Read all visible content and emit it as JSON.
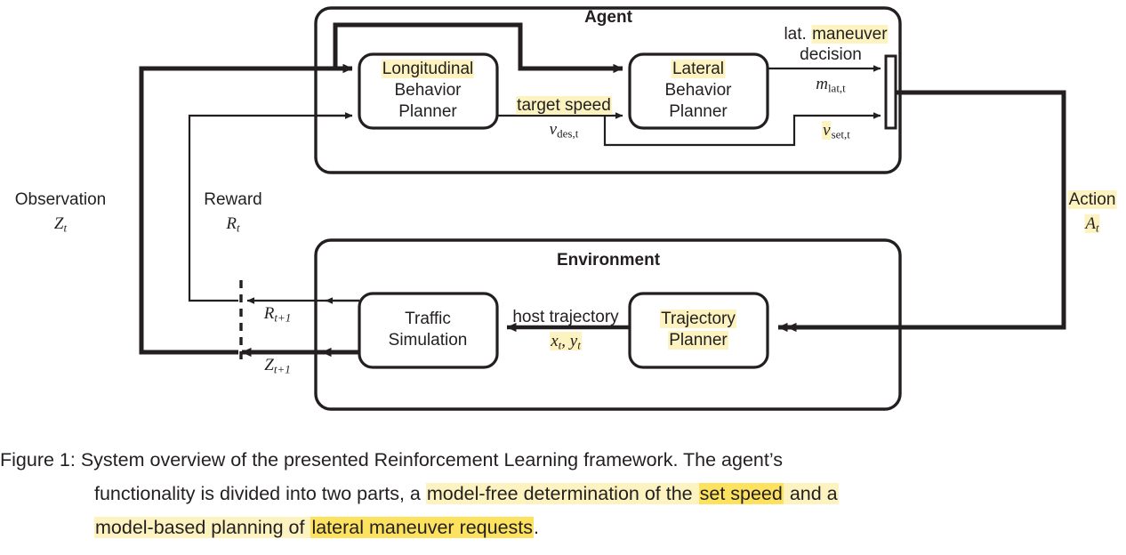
{
  "figure": {
    "agent_box_title": "Agent",
    "environment_box_title": "Environment",
    "blocks": {
      "longitudinal_behavior_planner": {
        "line1": "Longitudinal",
        "line2": "Behavior",
        "line3": "Planner"
      },
      "lateral_behavior_planner": {
        "line1": "Lateral",
        "line2": "Behavior",
        "line3": "Planner"
      },
      "traffic_simulation": {
        "line1": "Traffic",
        "line2": "Simulation"
      },
      "trajectory_planner": {
        "line1": "Trajectory",
        "line2": "Planner"
      }
    },
    "edge_labels": {
      "target_speed_text": "target speed",
      "v_des": "v",
      "v_des_sub": "des,t",
      "lat_maneuver_line1_plain": "lat. ",
      "lat_maneuver_line1_hl": "maneuver",
      "lat_maneuver_line2": "decision",
      "m_lat": "m",
      "m_lat_sub": "lat,t",
      "v_set": "v",
      "v_set_sub": "set,t",
      "host_trajectory_text": "host trajectory",
      "xt_yt": "x",
      "xt_yt_sub_1": "t",
      "xt_yt_mid": ", y",
      "xt_yt_sub_2": "t",
      "observation_text": "Observation",
      "observation_sym": "Z",
      "observation_sub": "t",
      "reward_text": "Reward",
      "reward_sym": "R",
      "reward_sub": "t",
      "action_text": "Action",
      "action_sym": "A",
      "action_sub": "t",
      "reward_next_sym": "R",
      "reward_next_sub": "t+1",
      "observation_next_sym": "Z",
      "observation_next_sub": "t+1"
    },
    "colors": {
      "stroke": "#231f20",
      "highlight_light": "#fcf3c0",
      "highlight_strong": "#fde25f",
      "background": "#ffffff"
    }
  },
  "caption": {
    "label": "Figure 1:",
    "line1_rest": " System overview of the presented Reinforcement Learning framework. The agent’s",
    "line2_plain_a": "functionality is divided into two parts, a ",
    "line2_hl_a": "model-free determination of the ",
    "line2_hl_strong": "set speed",
    "line2_hl_b": " and a",
    "line3_hl_a": "model-based planning of ",
    "line3_hl_strong": "lateral maneuver requests",
    "line3_rest": "."
  }
}
